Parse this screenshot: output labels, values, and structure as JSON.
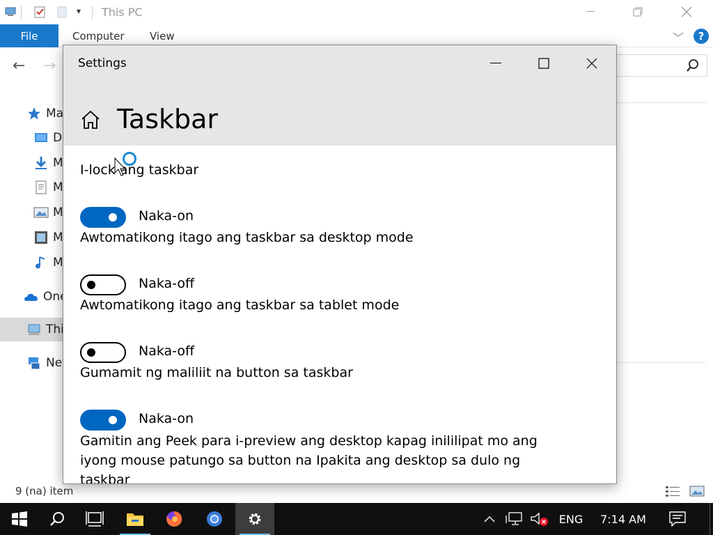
{
  "explorer": {
    "title": "This PC",
    "ribbon_tabs": {
      "file": "File",
      "computer": "Computer",
      "view": "View"
    },
    "help": "?",
    "nav_tree": [
      {
        "label": "Ma",
        "icon": "star-icon"
      },
      {
        "label": "D",
        "icon": "desktop-folder-icon"
      },
      {
        "label": "M",
        "icon": "downloads-icon"
      },
      {
        "label": "M",
        "icon": "documents-icon"
      },
      {
        "label": "M",
        "icon": "pictures-icon"
      },
      {
        "label": "M",
        "icon": "videos-icon"
      },
      {
        "label": "M",
        "icon": "music-icon"
      },
      {
        "label": "One",
        "icon": "onedrive-icon"
      },
      {
        "label": "This",
        "icon": "this-pc-icon",
        "selected": true
      },
      {
        "label": "Net",
        "icon": "network-icon"
      }
    ],
    "status": "9 (na) item"
  },
  "settings": {
    "window_title": "Settings",
    "page_title": "Taskbar",
    "options": [
      {
        "label": "I-lock ang taskbar",
        "state": "Naka-on",
        "on": true
      },
      {
        "label": "Awtomatikong itago ang taskbar sa desktop mode",
        "state": "Naka-off",
        "on": false
      },
      {
        "label": "Awtomatikong itago ang taskbar sa tablet mode",
        "state": "Naka-off",
        "on": false
      },
      {
        "label": "Gumamit ng maliliit na button sa taskbar",
        "state": "Naka-on",
        "on": true
      }
    ],
    "peek_description": "Gamitin ang Peek para i-preview ang desktop kapag inililipat mo ang iyong mouse patungo sa button na Ipakita ang desktop sa dulo ng taskbar"
  },
  "taskbar": {
    "language": "ENG",
    "time": "7:14 AM"
  },
  "colors": {
    "accent": "#0067c0",
    "file_tab": "#1979ca",
    "taskbar": "#101010"
  }
}
